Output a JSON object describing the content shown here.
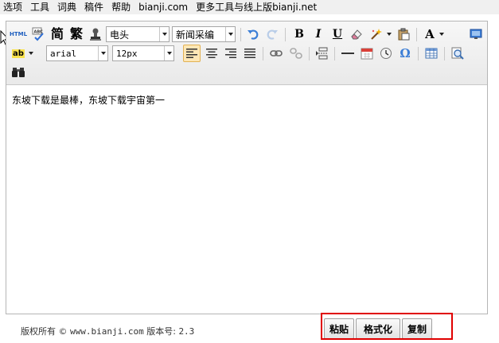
{
  "menu": [
    "选项",
    "工具",
    "词典",
    "稿件",
    "帮助",
    "bianji.com",
    "更多工具与线上版bianji.net"
  ],
  "toolbar": {
    "html_label": "HTML",
    "spell_label": "ABC",
    "simplified_label": "简",
    "traditional_label": "繁",
    "style_select": "电头",
    "format_select": "新闻采编",
    "bold_label": "B",
    "italic_label": "I",
    "underline_label": "U",
    "font_color_label": "A",
    "highlight_label": "ab",
    "font_family": "arial",
    "font_size": "12px",
    "omega_label": "Ω"
  },
  "editor": {
    "content": "东坡下载是最棒，东坡下载宇宙第一"
  },
  "footer": {
    "copyright_label": "版权所有 ©",
    "site": "www.bianji.com",
    "version_label": "版本号:",
    "version": "2.3"
  },
  "actions": {
    "paste": "粘贴",
    "format": "格式化",
    "copy": "复制"
  },
  "colors": {
    "menu_bg": "#f0f0f0",
    "toolbar_bg": "#efefef",
    "active_button_bg": "#fde7b6",
    "highlight_box": "#e00000",
    "icon_blue": "#3c7ed6"
  }
}
